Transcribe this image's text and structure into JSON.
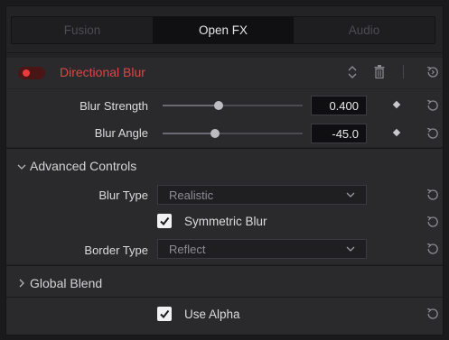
{
  "tabs": [
    {
      "label": "Fusion",
      "active": false
    },
    {
      "label": "Open FX",
      "active": true
    },
    {
      "label": "Audio",
      "active": false
    }
  ],
  "effect": {
    "title": "Directional Blur",
    "enabled": true,
    "accent": "#e04545"
  },
  "params": {
    "blur_strength": {
      "label": "Blur Strength",
      "value": "0.400",
      "slider_fraction": 0.4
    },
    "blur_angle": {
      "label": "Blur Angle",
      "value": "-45.0",
      "slider_fraction": 0.375
    }
  },
  "advanced": {
    "title": "Advanced Controls",
    "expanded": true,
    "blur_type": {
      "label": "Blur Type",
      "value": "Realistic"
    },
    "symmetric_blur": {
      "label": "Symmetric Blur",
      "checked": true
    },
    "border_type": {
      "label": "Border Type",
      "value": "Reflect"
    }
  },
  "global_blend": {
    "title": "Global Blend",
    "expanded": false
  },
  "use_alpha": {
    "label": "Use Alpha",
    "checked": true
  },
  "icons": [
    "chevron-up-down-icon",
    "trash-icon",
    "reset-icon",
    "diamond-keyframe-icon",
    "chevron-down-icon",
    "chevron-right-icon",
    "checkmark-icon"
  ]
}
